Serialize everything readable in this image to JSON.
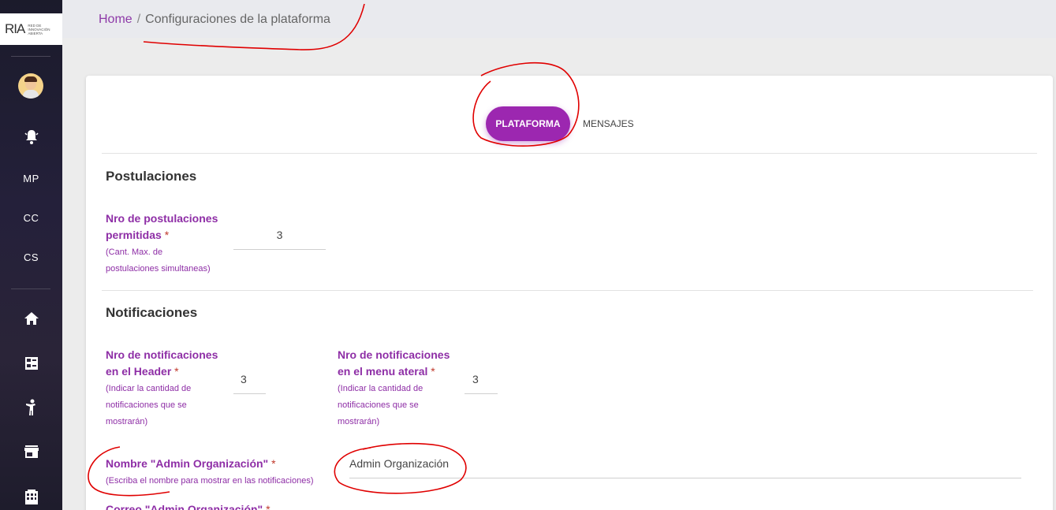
{
  "logo": {
    "main": "RIA",
    "sub": "Red de Innovación Abierta"
  },
  "sidebar": {
    "items": [
      {
        "icon": "notification-bell-icon"
      },
      {
        "label": "MP"
      },
      {
        "label": "CC"
      },
      {
        "label": "CS"
      },
      {
        "icon": "home-icon"
      },
      {
        "icon": "dashboard-list-icon"
      },
      {
        "icon": "person-icon"
      },
      {
        "icon": "store-icon"
      },
      {
        "icon": "building-icon"
      }
    ]
  },
  "breadcrumb": {
    "home": "Home",
    "separator": "/",
    "current": "Configuraciones de la plataforma"
  },
  "tabs": {
    "active": "PLATAFORMA",
    "other": "MENSAJES"
  },
  "postulaciones": {
    "title": "Postulaciones",
    "label_line1": "Nro de postulaciones",
    "label_line2": "permitidas",
    "required": "*",
    "hint_line1": "(Cant. Max. de",
    "hint_line2": "postulaciones simultaneas)",
    "value": "3"
  },
  "notificaciones": {
    "title": "Notificaciones",
    "header_label_line1": "Nro de notificaciones",
    "header_label_line2": "en el Header",
    "header_hint_line1": "(Indicar la cantidad de",
    "header_hint_line2": "notificaciones que se",
    "header_hint_line3": "mostrarán)",
    "header_value": "3",
    "menu_label_line1": "Nro de notificaciones",
    "menu_label_line2": "en el menu ateral",
    "menu_hint_line1": "(Indicar la cantidad de",
    "menu_hint_line2": "notificaciones que se",
    "menu_hint_line3": "mostrarán)",
    "menu_value": "3",
    "admin_name_label": "Nombre \"Admin Organización\"",
    "admin_name_hint": "(Escriba el nombre para mostrar en las notificaciones)",
    "admin_name_value": "Admin Organización",
    "admin_email_label": "Correo \"Admin Organización\"",
    "required": "*"
  },
  "colors": {
    "accent": "#9c27b0",
    "label": "#8e2ea6",
    "annotation": "#e00000"
  }
}
